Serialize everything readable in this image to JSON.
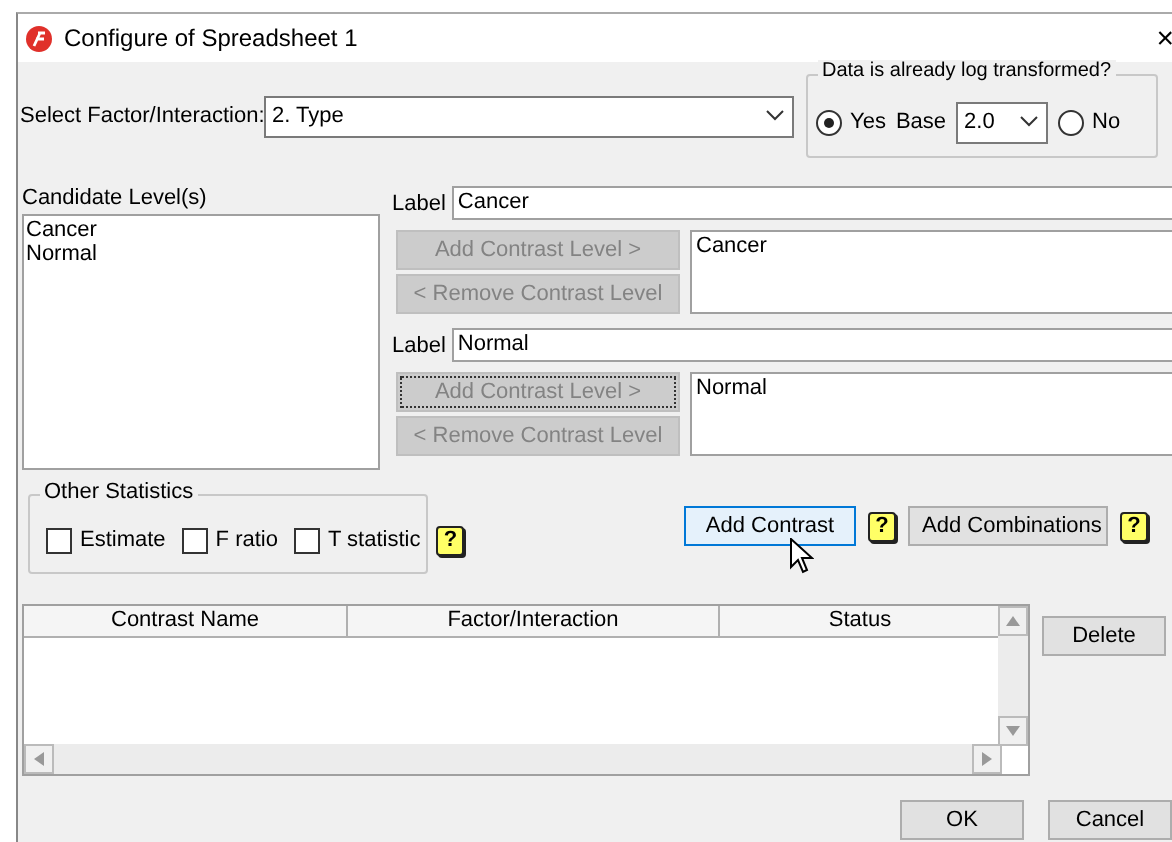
{
  "window": {
    "title": "Configure of Spreadsheet 1",
    "close": "×"
  },
  "factor_select": {
    "label": "Select Factor/Interaction:",
    "value": "2. Type"
  },
  "log_transform": {
    "title": "Data is already log transformed?",
    "base_label": "Base",
    "base_value": "2.0",
    "options": [
      {
        "label": "Yes",
        "selected": true
      },
      {
        "label": "No",
        "selected": false
      }
    ]
  },
  "candidate_levels": {
    "title": "Candidate Level(s)",
    "items": [
      "Cancer",
      "Normal"
    ]
  },
  "contrast_groups": [
    {
      "label_caption": "Label",
      "label_value": "Cancer",
      "add_button": {
        "label": "Add Contrast Level >",
        "disabled": true,
        "focused": false
      },
      "remove_button": {
        "label": "< Remove Contrast Level",
        "disabled": true,
        "focused": false
      },
      "levels": [
        "Cancer"
      ]
    },
    {
      "label_caption": "Label",
      "label_value": "Normal",
      "add_button": {
        "label": "Add Contrast Level >",
        "disabled": true,
        "focused": true
      },
      "remove_button": {
        "label": "< Remove Contrast Level",
        "disabled": true,
        "focused": false
      },
      "levels": [
        "Normal"
      ]
    }
  ],
  "other_statistics": {
    "title": "Other Statistics",
    "help": "?",
    "options": [
      {
        "label": "Estimate",
        "checked": false
      },
      {
        "label": "F ratio",
        "checked": false
      },
      {
        "label": "T statistic",
        "checked": false
      }
    ]
  },
  "actions": [
    {
      "label": "Add Contrast",
      "default": true,
      "help": "?"
    },
    {
      "label": "Add Combinations",
      "default": false,
      "help": "?"
    }
  ],
  "table": {
    "columns": [
      "Contrast Name",
      "Factor/Interaction",
      "Status"
    ]
  },
  "delete_button": "Delete",
  "buttons": [
    "OK",
    "Cancel"
  ]
}
